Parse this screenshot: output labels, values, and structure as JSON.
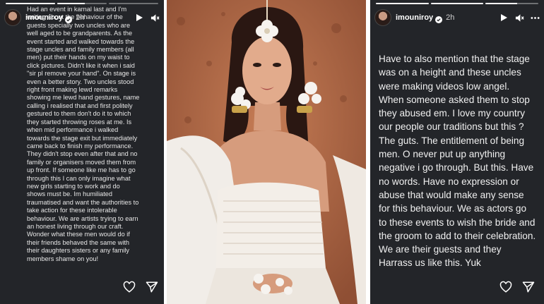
{
  "left_story": {
    "username": "imouniroy",
    "time": "2h",
    "progress_fraction": [
      1,
      0.55,
      0
    ],
    "text": "Had an event in karnal last and I'm writing about the behaviour of the guests specially two uncles who are well aged to be grandparents. As the event started and walked towards the stage uncles and family members (all men) put their hands on my waist to click pictures. Didn't like it when i said \"sir pl remove your hand\". On stage is even a better story. Two uncles stood right front making lewd remarks showing me lewd hand gestures, name calling i realised that and first politely gestured to them don't do it to which they started throwing roses at me. Is when mid performance i walked towards the stage exit but immediately came back to finish my performance. They didn't stop even after that and no family or organisers moved them from up front. If someone like me has to go through this I can only imagine what new girls starting to work and do shows must be. Im humiliated traumatised and want the authorities to take action for these intolerable behaviour. We are artists trying to earn an honest living through our craft. Wonder what these men would do if their friends behaved the same with their daughters sisters or any family members shame on you!"
  },
  "right_story": {
    "username": "imouniroy",
    "time": "2h",
    "progress_fraction": [
      1,
      1,
      0.6
    ],
    "text": "Have to also mention that the stage was on a height and these uncles were making videos low angel. When someone asked them to stop they abused em. I love my country our people our traditions but this ? The guts. The entitlement of being men. O never put up anything negative i go through. But this. Have no words. Have no expression or abuse that would make any sense for this behaviour. We as actors go to these events to wish the bride and the groom to add to their celebration. We are their guests and they Harrass us like this. Yuk"
  },
  "icons": {
    "play": "play-icon",
    "mute": "speaker-muted-icon",
    "more": "more-icon",
    "like": "heart-icon",
    "share": "send-icon",
    "verified": "verified-badge-icon"
  },
  "colors": {
    "story_bg": "#232529",
    "wall": "#b26c4a",
    "outfit": "#f3eee8"
  }
}
